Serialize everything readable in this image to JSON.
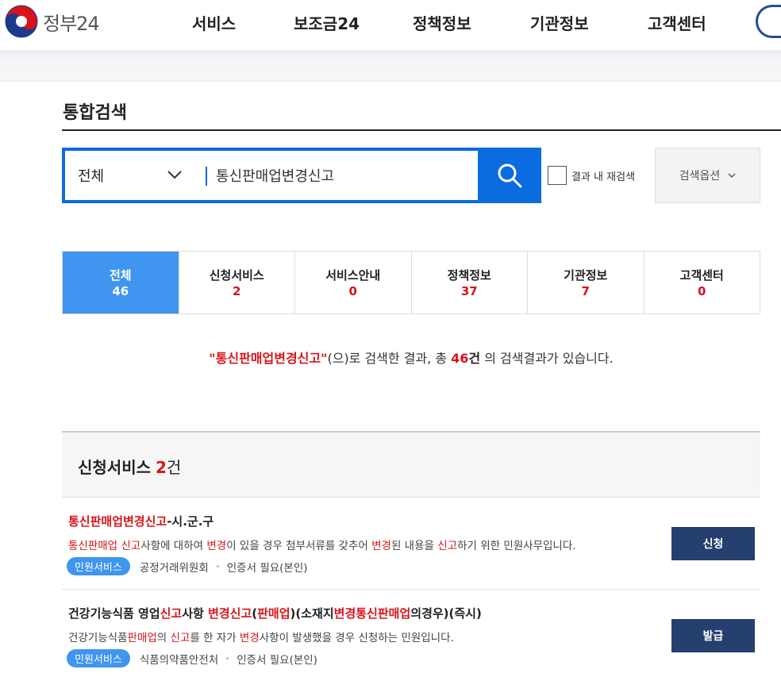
{
  "header": {
    "logo_text": "정부24",
    "nav": [
      "서비스",
      "보조금24",
      "정책정보",
      "기관정보",
      "고객센터"
    ]
  },
  "page": {
    "title": "통합검색"
  },
  "search": {
    "scope": "전체",
    "query": "통신판매업변경신고",
    "recheck_label": "결과 내 재검색",
    "options_label": "검색옵션"
  },
  "tabs": [
    {
      "label": "전체",
      "count": "46",
      "active": true
    },
    {
      "label": "신청서비스",
      "count": "2"
    },
    {
      "label": "서비스안내",
      "count": "0"
    },
    {
      "label": "정책정보",
      "count": "37"
    },
    {
      "label": "기관정보",
      "count": "7"
    },
    {
      "label": "고객센터",
      "count": "0"
    }
  ],
  "summary": {
    "keyword": "\"통신판매업변경신고\"",
    "mid": "(으)로 검색한 결과, 총 ",
    "total": "46",
    "unit": "건",
    "tail": " 의 검색결과가 있습니다."
  },
  "section": {
    "title": "신청서비스",
    "count": "2",
    "unit": "건"
  },
  "results": [
    {
      "title_parts": [
        {
          "text": "통신판매업변경신고",
          "hl": true
        },
        {
          "text": "-시.군.구",
          "hl": false
        }
      ],
      "desc_parts": [
        {
          "text": "통신판매업 신고",
          "hl": true
        },
        {
          "text": "사항에 대하여 ",
          "hl": false
        },
        {
          "text": "변경",
          "hl": true
        },
        {
          "text": "이 있을 경우 첨부서류를 갖추어 ",
          "hl": false
        },
        {
          "text": "변경",
          "hl": true
        },
        {
          "text": "된 내용을 ",
          "hl": false
        },
        {
          "text": "신고",
          "hl": true
        },
        {
          "text": "하기 위한 민원사무입니다.",
          "hl": false
        }
      ],
      "badge": "민원서비스",
      "org": "공정거래위원회",
      "cert": "인증서 필요(본인)",
      "button": "신청"
    },
    {
      "title_parts": [
        {
          "text": "건강기능식품 영업",
          "hl": false
        },
        {
          "text": "신고",
          "hl": true
        },
        {
          "text": "사항 ",
          "hl": false
        },
        {
          "text": "변경신고",
          "hl": true
        },
        {
          "text": "(",
          "hl": false
        },
        {
          "text": "판매업",
          "hl": true
        },
        {
          "text": ")(소재지",
          "hl": false
        },
        {
          "text": "변경통신판매업",
          "hl": true
        },
        {
          "text": "의경우)(즉시)",
          "hl": false
        }
      ],
      "desc_parts": [
        {
          "text": "건강기능식품",
          "hl": false
        },
        {
          "text": "판매업",
          "hl": true
        },
        {
          "text": "의 ",
          "hl": false
        },
        {
          "text": "신고",
          "hl": true
        },
        {
          "text": "를 한 자가 ",
          "hl": false
        },
        {
          "text": "변경",
          "hl": true
        },
        {
          "text": "사항이 발생했을 경우 신청하는 민원입니다.",
          "hl": false
        }
      ],
      "badge": "민원서비스",
      "org": "식품의약품안전처",
      "cert": "인증서 필요(본인)",
      "button": "발급"
    }
  ]
}
